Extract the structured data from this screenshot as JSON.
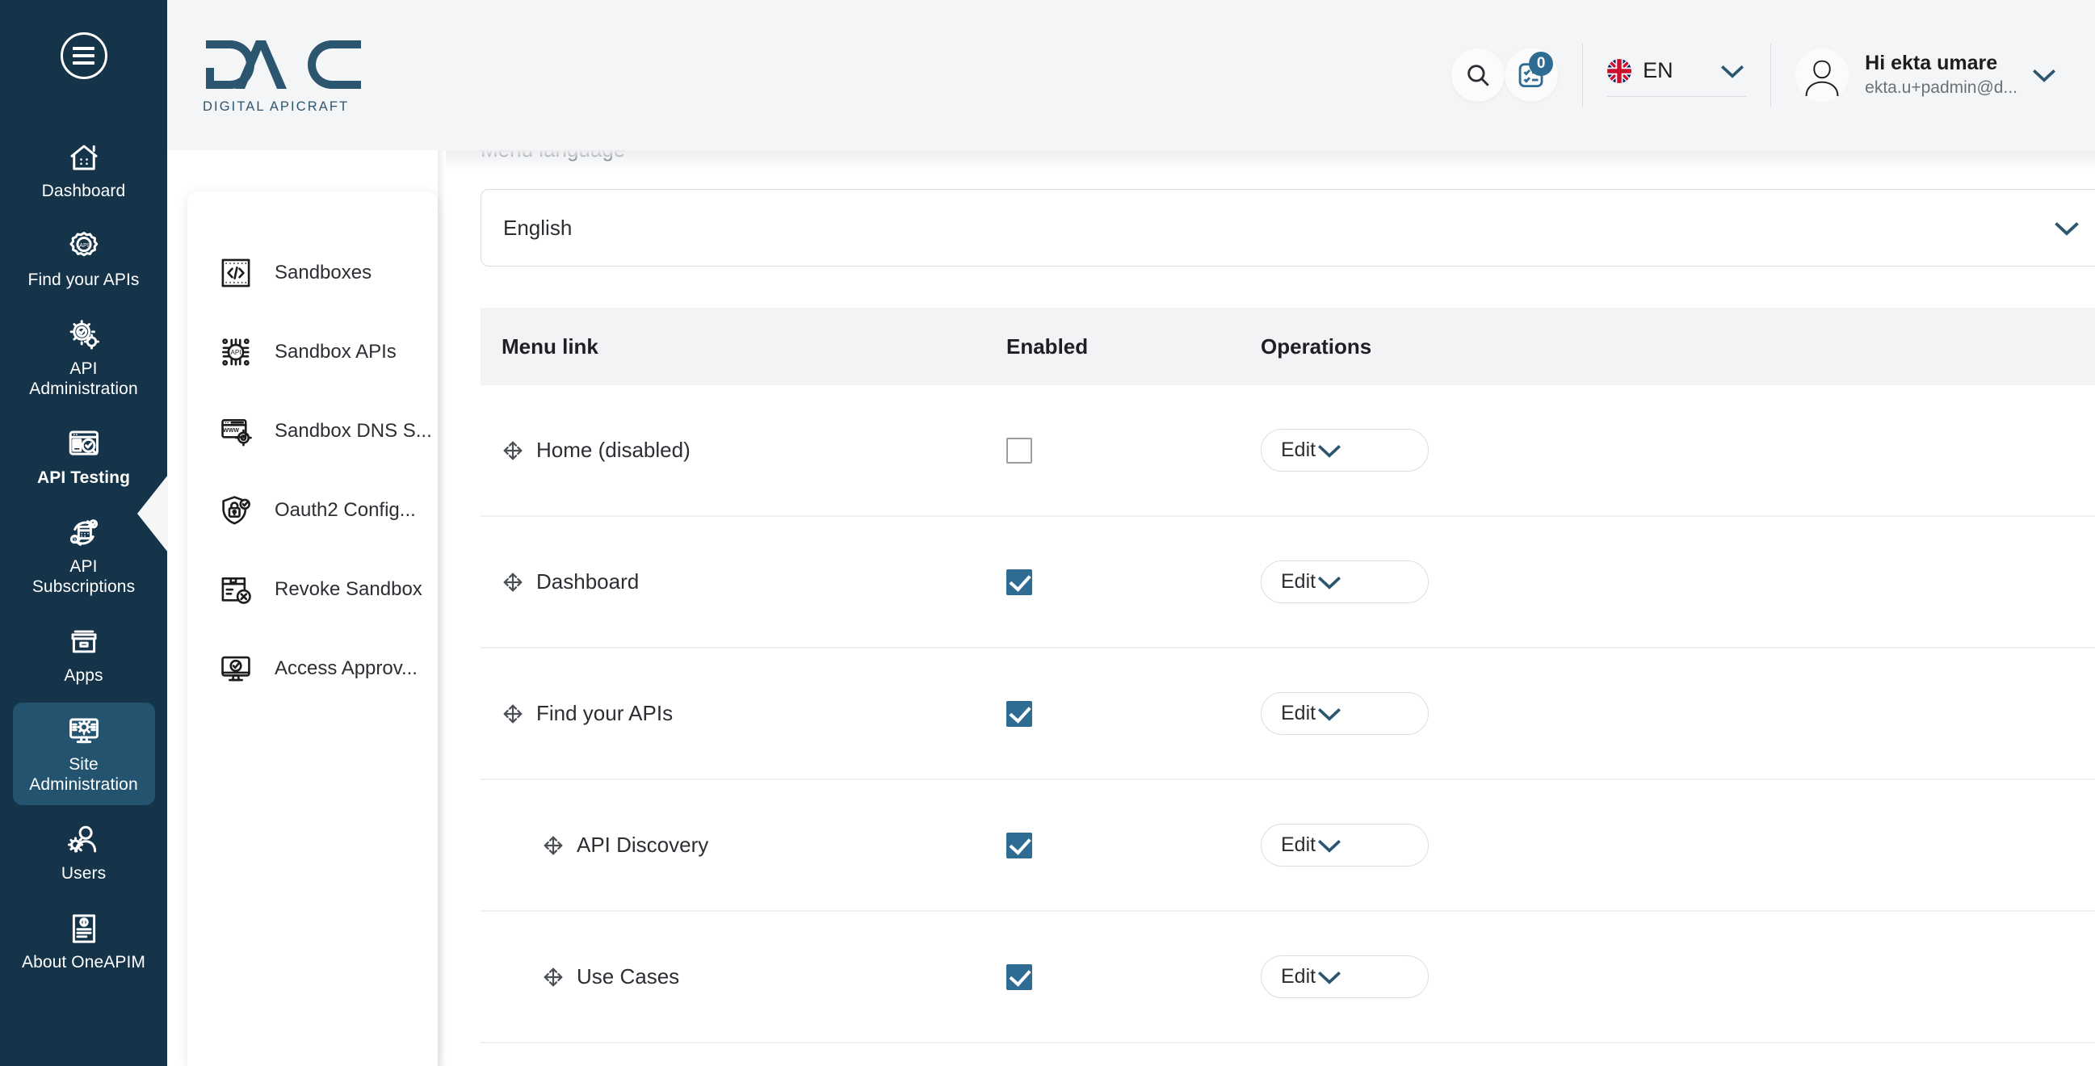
{
  "sidebar": {
    "menu_toggle": "menu-toggle",
    "items": [
      {
        "label": "Dashboard",
        "icon": "home-dashboard-icon",
        "active": false,
        "bold": false
      },
      {
        "label": "Find your APIs",
        "icon": "api-gear-icon",
        "active": false,
        "bold": false
      },
      {
        "label": "API Administration",
        "icon": "api-admin-gears-icon",
        "active": false,
        "bold": false
      },
      {
        "label": "API Testing",
        "icon": "api-testing-icon",
        "active": false,
        "bold": true
      },
      {
        "label": "API Subscriptions",
        "icon": "api-subscriptions-icon",
        "active": false,
        "bold": false
      },
      {
        "label": "Apps",
        "icon": "apps-box-icon",
        "active": false,
        "bold": false
      },
      {
        "label": "Site Administration",
        "icon": "site-admin-monitor-icon",
        "active": true,
        "bold": false
      },
      {
        "label": "Users",
        "icon": "users-icon",
        "active": false,
        "bold": false
      },
      {
        "label": "About OneAPIM",
        "icon": "about-document-icon",
        "active": false,
        "bold": false
      }
    ]
  },
  "header": {
    "logo_text": "DAC",
    "logo_subtitle": "DIGITAL APICRAFT",
    "search_icon": "search-icon",
    "tasks_icon": "tasks-clipboard-icon",
    "tasks_badge": "0",
    "language": {
      "flag": "uk-flag-icon",
      "code": "EN"
    },
    "user": {
      "greeting": "Hi ekta umare",
      "email": "ekta.u+padmin@d...",
      "avatar": "user-avatar-icon"
    }
  },
  "panel": {
    "items": [
      {
        "label": "Sandboxes",
        "icon": "code-brackets-icon"
      },
      {
        "label": "Sandbox APIs",
        "icon": "api-chip-icon"
      },
      {
        "label": "Sandbox DNS S...",
        "icon": "www-browser-gear-icon"
      },
      {
        "label": "Oauth2 Config...",
        "icon": "shield-lock-icon"
      },
      {
        "label": "Revoke Sandbox",
        "icon": "box-revoke-icon"
      },
      {
        "label": "Access Approv...",
        "icon": "monitor-check-icon"
      }
    ]
  },
  "main": {
    "menu_language_label": "Menu language",
    "menu_language_value": "English",
    "table": {
      "headers": {
        "link": "Menu link",
        "enabled": "Enabled",
        "operations": "Operations"
      },
      "rows": [
        {
          "label": "Home (disabled)",
          "enabled": false,
          "indent": false,
          "operation": "Edit"
        },
        {
          "label": "Dashboard",
          "enabled": true,
          "indent": false,
          "operation": "Edit"
        },
        {
          "label": "Find your APIs",
          "enabled": true,
          "indent": false,
          "operation": "Edit"
        },
        {
          "label": "API Discovery",
          "enabled": true,
          "indent": true,
          "operation": "Edit"
        },
        {
          "label": "Use Cases",
          "enabled": true,
          "indent": true,
          "operation": "Edit"
        }
      ]
    }
  },
  "colors": {
    "sidebar_bg": "#153349",
    "sidebar_active": "#23536f",
    "accent_blue": "#2e6c93",
    "header_bg": "#f4f5f6",
    "table_header_bg": "#f2f3f4"
  }
}
